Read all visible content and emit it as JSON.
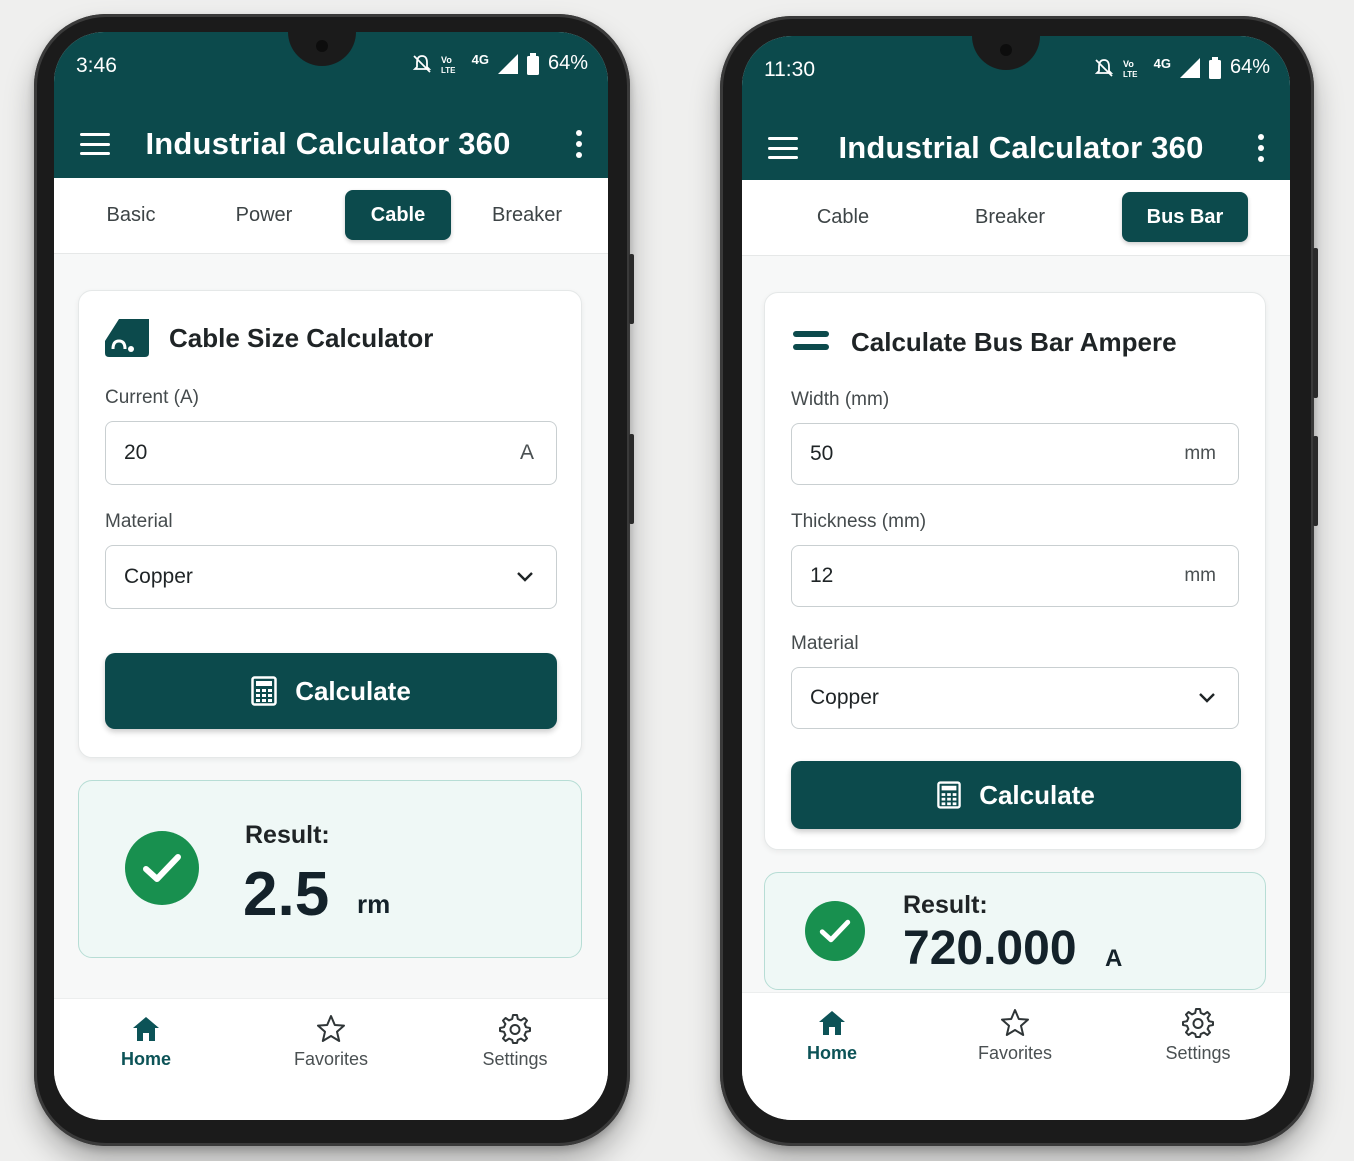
{
  "colors": {
    "primary": "#0c4a4c",
    "success": "#18904f",
    "result_bg": "#eff8f6"
  },
  "phones": [
    {
      "status": {
        "time": "3:46",
        "battery": "64%",
        "network": "4G"
      },
      "app_title": "Industrial Calculator 360",
      "tabs": [
        "Basic",
        "Power",
        "Cable",
        "Breaker"
      ],
      "active_tab": "Cable",
      "card": {
        "icon": "cable-icon",
        "title": "Cable Size Calculator",
        "fields": [
          {
            "label": "Current (A)",
            "value": "20",
            "unit": "A"
          }
        ],
        "select": {
          "label": "Material",
          "value": "Copper"
        },
        "button": "Calculate"
      },
      "result": {
        "label": "Result:",
        "value": "2.5",
        "unit": "rm"
      },
      "nav": [
        "Home",
        "Favorites",
        "Settings"
      ],
      "active_nav": "Home"
    },
    {
      "status": {
        "time": "11:30",
        "battery": "64%",
        "network": "4G"
      },
      "app_title": "Industrial Calculator 360",
      "tabs": [
        "Cable",
        "Breaker",
        "Bus Bar"
      ],
      "active_tab": "Bus Bar",
      "card": {
        "icon": "bus-bar-icon",
        "title": "Calculate Bus Bar Ampere",
        "fields": [
          {
            "label": "Width (mm)",
            "value": "50",
            "unit": "mm"
          },
          {
            "label": "Thickness (mm)",
            "value": "12",
            "unit": "mm"
          }
        ],
        "select": {
          "label": "Material",
          "value": "Copper"
        },
        "button": "Calculate"
      },
      "result": {
        "label": "Result:",
        "value": "720.000",
        "unit": "A"
      },
      "nav": [
        "Home",
        "Favorites",
        "Settings"
      ],
      "active_nav": "Home"
    }
  ]
}
